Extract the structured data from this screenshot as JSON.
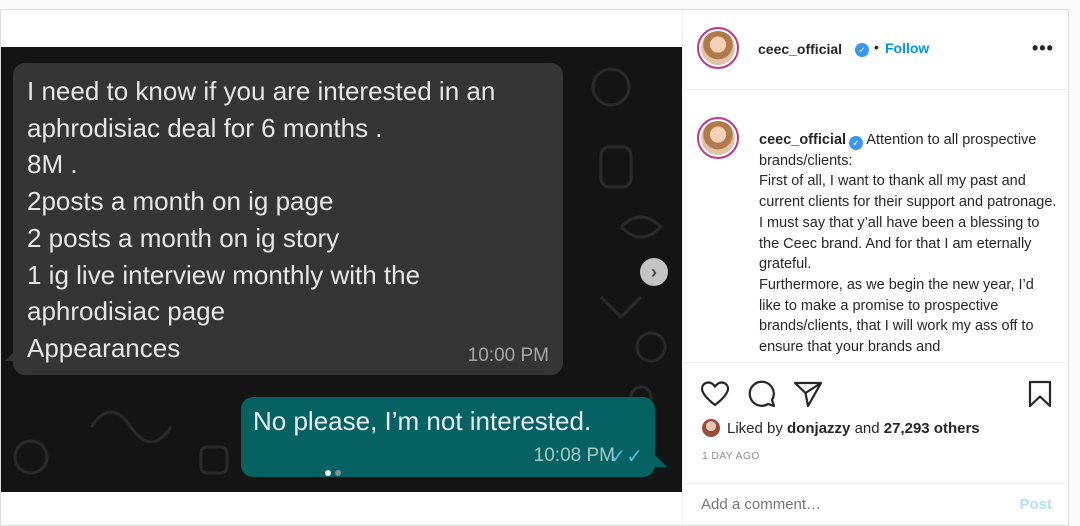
{
  "chat": {
    "incoming_text": "I need to know if you are interested in an\naphrodisiac deal for 6 months .\n8M .\n2posts a month on ig page\n2 posts a month on ig story\n1 ig live interview monthly with the\naphrodisiac page\nAppearances",
    "incoming_time": "10:00 PM",
    "outgoing_text": "No please, I’m not interested.",
    "outgoing_time": "10:08 PM",
    "read_ticks": "✓✓"
  },
  "carousel": {
    "next_glyph": "›",
    "current_slide": 1,
    "slide_count": 2
  },
  "header": {
    "username": "ceec_official",
    "separator": "•",
    "follow_label": "Follow",
    "more_glyph": "•••"
  },
  "caption": {
    "username": "ceec_official",
    "text": "Attention to all prospective brands/clients:\nFirst of all, I want to thank all my past and current clients for their support and patronage. I must say that y’all have been a blessing to the Ceec brand. And for that I am eternally grateful.\nFurthermore, as we begin the new year, I’d like to make a promise to prospective brands/clients, that I will work my ass off to ensure that your brands and"
  },
  "likes": {
    "prefix": "Liked by",
    "liker": "donjazzy",
    "conjunction": "and",
    "others": "27,293 others"
  },
  "time_ago": "1 DAY AGO",
  "comment": {
    "placeholder": "Add a comment…",
    "post_label": "Post"
  },
  "icons": {
    "verified": "verified-badge-icon",
    "heart": "heart-icon",
    "comment": "comment-icon",
    "share": "share-icon",
    "save": "bookmark-icon"
  },
  "colors": {
    "link_blue": "#0095f6",
    "verified_blue": "#3897f0",
    "outgoing_bubble": "#056162",
    "incoming_bubble": "#353535",
    "read_ticks": "#53bdeb"
  }
}
